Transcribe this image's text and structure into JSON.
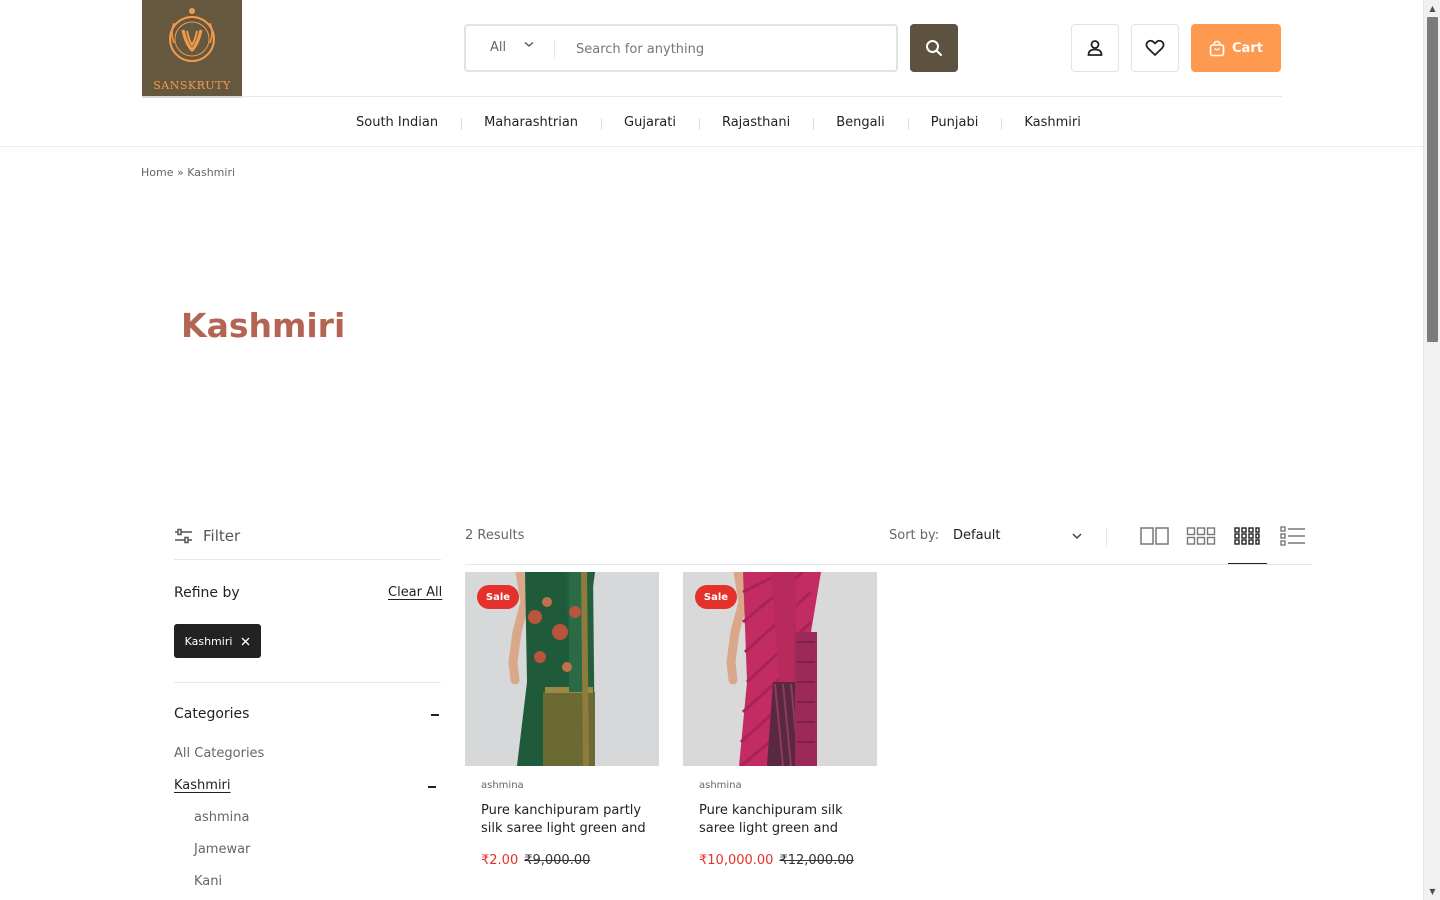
{
  "brand": {
    "name": "SANSKRUTY"
  },
  "search": {
    "category": "All",
    "placeholder": "Search for anything"
  },
  "header": {
    "cart_label": "Cart"
  },
  "nav": {
    "items": [
      "South Indian",
      "Maharashtrian",
      "Gujarati",
      "Rajasthani",
      "Bengali",
      "Punjabi",
      "Kashmiri"
    ]
  },
  "breadcrumb": {
    "home": "Home",
    "separator": "»",
    "current": "Kashmiri"
  },
  "page": {
    "title": "Kashmiri"
  },
  "filter": {
    "label": "Filter",
    "refine_by": "Refine by",
    "clear_all": "Clear All",
    "active_chip": "Kashmiri",
    "categories_heading": "Categories",
    "categories": {
      "all": "All Categories",
      "parent": "Kashmiri",
      "children": [
        "ashmina",
        "Jamewar",
        "Kani"
      ]
    }
  },
  "results": {
    "count_text": "2 Results",
    "sort_label": "Sort by:",
    "sort_value": "Default"
  },
  "products": [
    {
      "badge": "Sale",
      "brand": "ashmina",
      "name": "Pure kanchipuram partly silk saree light green and",
      "price": "₹2.00",
      "old_price": "₹9,000.00"
    },
    {
      "badge": "Sale",
      "brand": "ashmina",
      "name": "Pure kanchipuram silk saree light green and",
      "price": "₹10,000.00",
      "old_price": "₹12,000.00"
    }
  ],
  "colors": {
    "accent": "#fd9a4f",
    "search_button": "#5d5140",
    "title": "#b26553",
    "sale": "#e4312b",
    "logo_bg": "#66583f"
  }
}
